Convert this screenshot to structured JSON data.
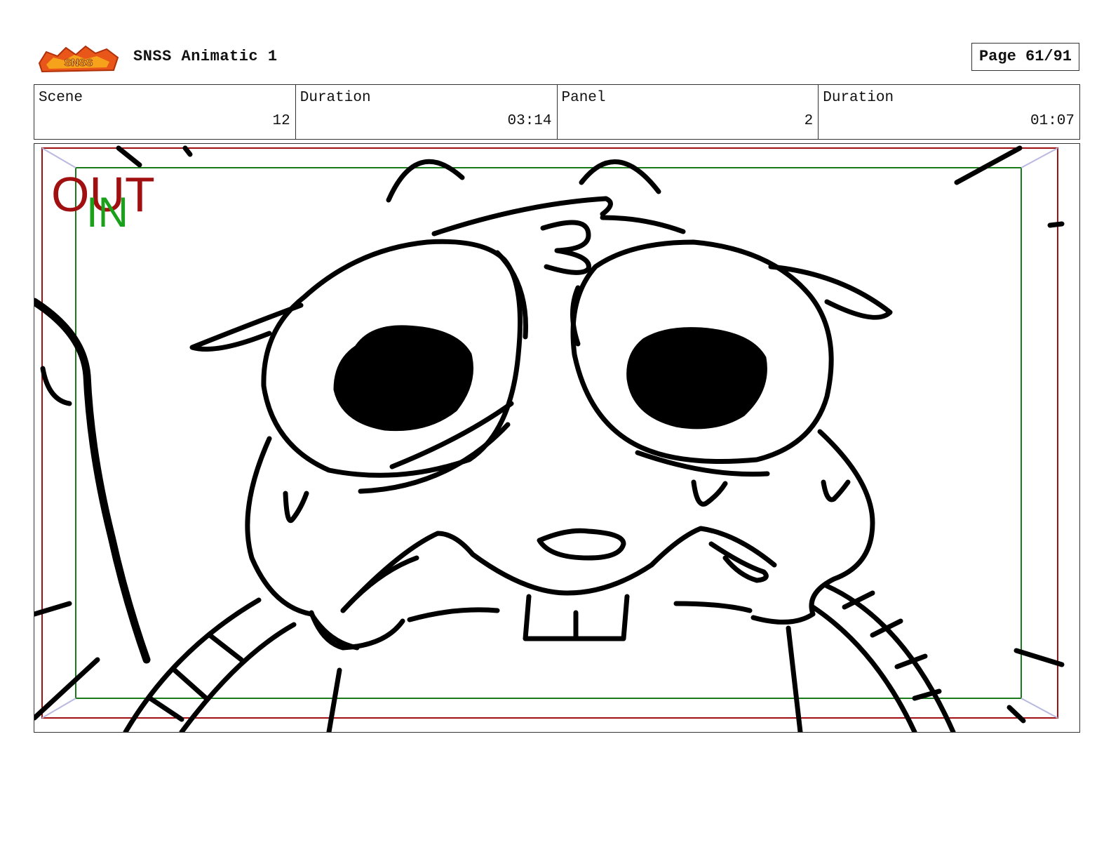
{
  "header": {
    "logo_text": "SNSS",
    "title": "SNSS Animatic 1",
    "page_label": "Page 61/91"
  },
  "info": {
    "scene_label": "Scene",
    "scene_value": "12",
    "scene_duration_label": "Duration",
    "scene_duration_value": "03:14",
    "panel_label": "Panel",
    "panel_value": "2",
    "panel_duration_label": "Duration",
    "panel_duration_value": "01:07"
  },
  "frame": {
    "out_label": "OUT",
    "in_label": "IN",
    "out_color": "#a01010",
    "in_color": "#1aa01a"
  }
}
